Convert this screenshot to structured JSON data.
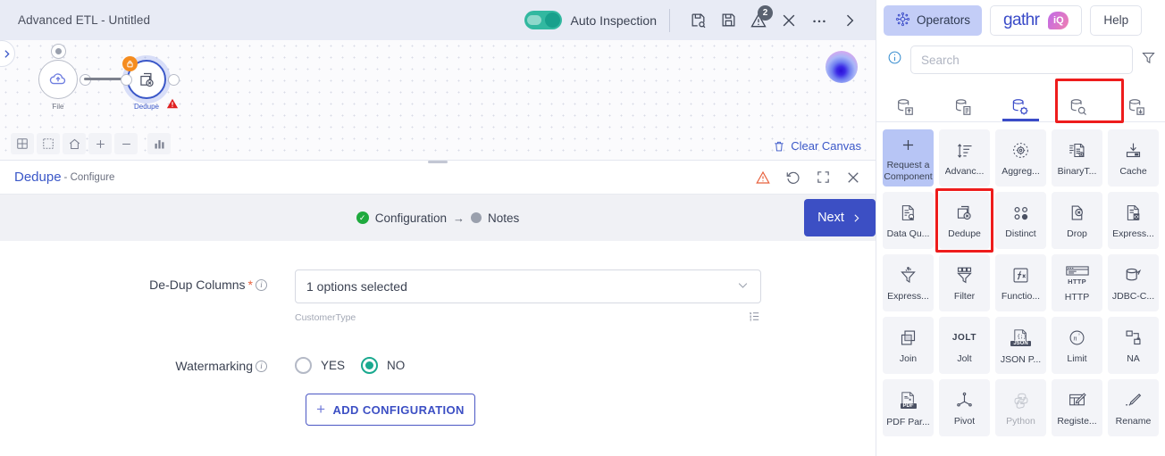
{
  "topbar": {
    "app_title": "Advanced ETL - Untitled",
    "auto_inspection_label": "Auto Inspection",
    "auto_inspection_on": true,
    "icons": [
      {
        "name": "inspect-save-icon",
        "glyph": "save-search"
      },
      {
        "name": "save-icon",
        "glyph": "floppy"
      },
      {
        "name": "warnings-icon",
        "glyph": "warning-triangle",
        "badge": "2"
      },
      {
        "name": "close-icon",
        "glyph": "cross"
      },
      {
        "name": "more-options-icon",
        "glyph": "ellipsis"
      },
      {
        "name": "expand-right-icon",
        "glyph": "chevron-right"
      }
    ]
  },
  "canvas": {
    "clear_canvas_label": "Clear Canvas",
    "nodes": [
      {
        "label": "File",
        "selected": false,
        "locked": false,
        "warning": false
      },
      {
        "label": "Dedupe",
        "selected": true,
        "locked": true,
        "warning": true
      }
    ],
    "tools": [
      {
        "name": "grid-layout-icon",
        "glyph": "grid"
      },
      {
        "name": "select-area-icon",
        "glyph": "dashed-box"
      },
      {
        "name": "home-icon",
        "glyph": "home"
      },
      {
        "name": "zoom-in-icon",
        "glyph": "plus"
      },
      {
        "name": "zoom-out-icon",
        "glyph": "minus"
      },
      {
        "name": "chart-icon",
        "glyph": "bars"
      }
    ],
    "assistant_orb": "ai-assistant-orb"
  },
  "config": {
    "title": "Dedupe",
    "subtitle": "- Configure",
    "actions": [
      {
        "name": "error-warning-icon",
        "glyph": "triangle"
      },
      {
        "name": "reset-icon",
        "glyph": "undo"
      },
      {
        "name": "fullscreen-icon",
        "glyph": "expand"
      },
      {
        "name": "close-panel-icon",
        "glyph": "cross"
      }
    ],
    "steps": [
      {
        "label": "Configuration",
        "state": "done"
      },
      {
        "label": "Notes",
        "state": "todo"
      }
    ],
    "step_arrow": "→",
    "next_label": "Next",
    "fields": {
      "dedup_columns": {
        "label": "De-Dup Columns",
        "required": true,
        "value": "1 options selected",
        "helper": "CustomerType"
      },
      "watermarking": {
        "label": "Watermarking",
        "options": [
          "YES",
          "NO"
        ],
        "selected": "NO"
      }
    },
    "add_configuration_label": "ADD CONFIGURATION"
  },
  "right_panel": {
    "tabs": [
      {
        "label": "Operators",
        "active": true,
        "icon": "operators-icon"
      },
      {
        "label": "gathr",
        "badge": "iQ",
        "active": false,
        "icon": "gathr-logo"
      },
      {
        "label": "Help",
        "active": false
      }
    ],
    "search": {
      "placeholder": "Search",
      "value": ""
    },
    "info_icon": "info-icon",
    "filter_icon": "filter-icon",
    "category_tabs": [
      {
        "name": "source-icon",
        "active": false
      },
      {
        "name": "dataset-icon",
        "active": false
      },
      {
        "name": "processors-icon",
        "active": true
      },
      {
        "name": "inspect-icon",
        "active": false
      },
      {
        "name": "emitter-icon",
        "active": false
      }
    ],
    "operators": [
      {
        "label": "Request a Component",
        "icon": "plus-icon",
        "style": "request",
        "highlight": false
      },
      {
        "label": "Advanc...",
        "icon": "advanced-sort-icon",
        "highlight": false
      },
      {
        "label": "Aggreg...",
        "icon": "aggregation-icon",
        "highlight": false
      },
      {
        "label": "BinaryT...",
        "icon": "binary-transform-icon",
        "highlight": false
      },
      {
        "label": "Cache",
        "icon": "cache-icon",
        "highlight": false
      },
      {
        "label": "Data Qu...",
        "icon": "data-quality-icon",
        "highlight": false
      },
      {
        "label": "Dedupe",
        "icon": "dedupe-icon",
        "highlight": true
      },
      {
        "label": "Distinct",
        "icon": "distinct-icon",
        "highlight": false
      },
      {
        "label": "Drop",
        "icon": "drop-icon",
        "highlight": false
      },
      {
        "label": "Express...",
        "icon": "expression-evaluator-icon",
        "highlight": false
      },
      {
        "label": "Express...",
        "icon": "expression-filter-icon",
        "highlight": false
      },
      {
        "label": "Filter",
        "icon": "filter-funnel-icon",
        "highlight": false
      },
      {
        "label": "Functio...",
        "icon": "function-icon",
        "highlight": false
      },
      {
        "label": "HTTP",
        "icon": "http-icon",
        "highlight": false
      },
      {
        "label": "JDBC-C...",
        "icon": "jdbc-container-icon",
        "highlight": false
      },
      {
        "label": "Join",
        "icon": "join-icon",
        "highlight": false
      },
      {
        "label": "Jolt",
        "icon": "jolt-icon",
        "highlight": false
      },
      {
        "label": "JSON P...",
        "icon": "json-parser-icon",
        "highlight": false
      },
      {
        "label": "Limit",
        "icon": "limit-icon",
        "highlight": false
      },
      {
        "label": "NA",
        "icon": "na-icon",
        "highlight": false
      },
      {
        "label": "PDF Par...",
        "icon": "pdf-parser-icon",
        "highlight": false
      },
      {
        "label": "Pivot",
        "icon": "pivot-icon",
        "highlight": false
      },
      {
        "label": "Python",
        "icon": "python-icon",
        "disabled": true,
        "highlight": false
      },
      {
        "label": "Registe...",
        "icon": "register-icon",
        "highlight": false
      },
      {
        "label": "Rename",
        "icon": "rename-icon",
        "highlight": false
      }
    ]
  },
  "colors": {
    "accent_blue": "#3a4bc8",
    "topbar_bg": "#e8ebf5",
    "toggle_green": "#18a08c",
    "highlight_red": "#ee1c1c",
    "warning_orange": "#f58c1f",
    "error_red": "#e02020",
    "step_done_green": "#1faa3e"
  }
}
